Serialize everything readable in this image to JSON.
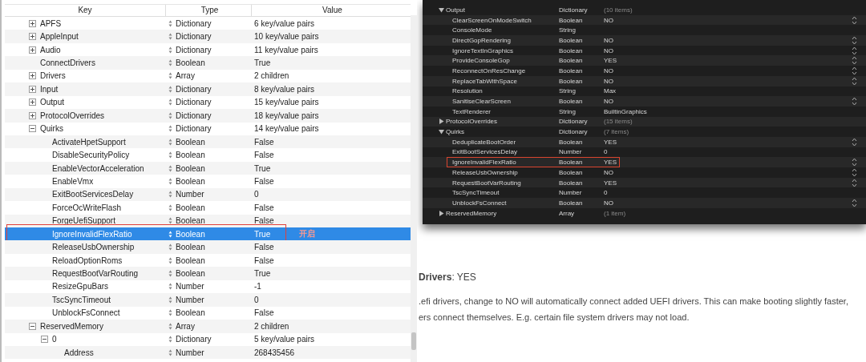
{
  "plist_editor": {
    "columns": [
      "Key",
      "Type",
      "Value"
    ],
    "rows": [
      {
        "key": "APFS",
        "kind": "group",
        "expanded": false,
        "type": "Dictionary",
        "value": "6 key/value pairs",
        "selected": false
      },
      {
        "key": "AppleInput",
        "kind": "group",
        "expanded": false,
        "type": "Dictionary",
        "value": "10 key/value pairs",
        "selected": false
      },
      {
        "key": "Audio",
        "kind": "group",
        "expanded": false,
        "type": "Dictionary",
        "value": "11 key/value pairs",
        "selected": false
      },
      {
        "key": "ConnectDrivers",
        "kind": "leaf",
        "type": "Boolean",
        "value": "True",
        "selected": false
      },
      {
        "key": "Drivers",
        "kind": "group",
        "expanded": false,
        "type": "Array",
        "value": "2 children",
        "selected": false
      },
      {
        "key": "Input",
        "kind": "group",
        "expanded": false,
        "type": "Dictionary",
        "value": "8 key/value pairs",
        "selected": false
      },
      {
        "key": "Output",
        "kind": "group",
        "expanded": false,
        "type": "Dictionary",
        "value": "15 key/value pairs",
        "selected": false
      },
      {
        "key": "ProtocolOverrides",
        "kind": "group",
        "expanded": false,
        "type": "Dictionary",
        "value": "18 key/value pairs",
        "selected": false
      },
      {
        "key": "Quirks",
        "kind": "group",
        "expanded": true,
        "type": "Dictionary",
        "value": "14 key/value pairs",
        "selected": false,
        "children": [
          {
            "key": "ActivateHpetSupport",
            "kind": "leaf",
            "type": "Boolean",
            "value": "False",
            "selected": false
          },
          {
            "key": "DisableSecurityPolicy",
            "kind": "leaf",
            "type": "Boolean",
            "value": "False",
            "selected": false
          },
          {
            "key": "EnableVectorAcceleration",
            "kind": "leaf",
            "type": "Boolean",
            "value": "True",
            "selected": false
          },
          {
            "key": "EnableVmx",
            "kind": "leaf",
            "type": "Boolean",
            "value": "False",
            "selected": false
          },
          {
            "key": "ExitBootServicesDelay",
            "kind": "leaf",
            "type": "Number",
            "value": "0",
            "selected": false
          },
          {
            "key": "ForceOcWriteFlash",
            "kind": "leaf",
            "type": "Boolean",
            "value": "False",
            "selected": false
          },
          {
            "key": "ForgeUefiSupport",
            "kind": "leaf",
            "type": "Boolean",
            "value": "False",
            "selected": false
          },
          {
            "key": "IgnoreInvalidFlexRatio",
            "kind": "leaf",
            "type": "Boolean",
            "value": "True",
            "selected": true,
            "highlighted": true
          },
          {
            "key": "ReleaseUsbOwnership",
            "kind": "leaf",
            "type": "Boolean",
            "value": "False",
            "selected": false
          },
          {
            "key": "ReloadOptionRoms",
            "kind": "leaf",
            "type": "Boolean",
            "value": "False",
            "selected": false
          },
          {
            "key": "RequestBootVarRouting",
            "kind": "leaf",
            "type": "Boolean",
            "value": "True",
            "selected": false
          },
          {
            "key": "ResizeGpuBars",
            "kind": "leaf",
            "type": "Number",
            "value": "-1",
            "selected": false
          },
          {
            "key": "TscSyncTimeout",
            "kind": "leaf",
            "type": "Number",
            "value": "0",
            "selected": false
          },
          {
            "key": "UnblockFsConnect",
            "kind": "leaf",
            "type": "Boolean",
            "value": "False",
            "selected": false
          }
        ]
      },
      {
        "key": "ReservedMemory",
        "kind": "group",
        "expanded": true,
        "type": "Array",
        "value": "2 children",
        "selected": false,
        "children": [
          {
            "key": "0",
            "kind": "group",
            "expanded": true,
            "type": "Dictionary",
            "value": "5 key/value pairs",
            "selected": false,
            "children": [
              {
                "key": "Address",
                "kind": "leaf",
                "type": "Number",
                "value": "268435456",
                "selected": false
              }
            ]
          }
        ]
      }
    ],
    "annotation": "开启"
  },
  "dark_editor": {
    "rows": [
      {
        "key": "Output",
        "kind": "group",
        "expanded": true,
        "type": "Dictionary",
        "value": "(10 items)",
        "children": [
          {
            "key": "ClearScreenOnModeSwitch",
            "kind": "leaf",
            "type": "Boolean",
            "value": "NO",
            "stepper": true
          },
          {
            "key": "ConsoleMode",
            "kind": "leaf",
            "type": "String",
            "stepper": false
          },
          {
            "key": "DirectGopRendering",
            "kind": "leaf",
            "type": "Boolean",
            "value": "NO",
            "stepper": true
          },
          {
            "key": "IgnoreTextInGraphics",
            "kind": "leaf",
            "type": "Boolean",
            "value": "NO",
            "stepper": true
          },
          {
            "key": "ProvideConsoleGop",
            "kind": "leaf",
            "type": "Boolean",
            "value": "YES",
            "stepper": true
          },
          {
            "key": "ReconnectOnResChange",
            "kind": "leaf",
            "type": "Boolean",
            "value": "NO",
            "stepper": true
          },
          {
            "key": "ReplaceTabWithSpace",
            "kind": "leaf",
            "type": "Boolean",
            "value": "NO",
            "stepper": true
          },
          {
            "key": "Resolution",
            "kind": "leaf",
            "type": "String",
            "value": "Max",
            "stepper": false
          },
          {
            "key": "SanitiseClearScreen",
            "kind": "leaf",
            "type": "Boolean",
            "value": "NO",
            "stepper": true
          },
          {
            "key": "TextRenderer",
            "kind": "leaf",
            "type": "String",
            "value": "BuiltinGraphics",
            "stepper": false
          }
        ]
      },
      {
        "key": "ProtocolOverrides",
        "kind": "group",
        "expanded": false,
        "type": "Dictionary",
        "value": "(15 items)"
      },
      {
        "key": "Quirks",
        "kind": "group",
        "expanded": true,
        "type": "Dictionary",
        "value": "(7 items)",
        "children": [
          {
            "key": "DeduplicateBootOrder",
            "kind": "leaf",
            "type": "Boolean",
            "value": "YES",
            "stepper": true
          },
          {
            "key": "ExitBootServicesDelay",
            "kind": "leaf",
            "type": "Number",
            "value": "0",
            "stepper": false
          },
          {
            "key": "IgnoreInvalidFlexRatio",
            "kind": "leaf",
            "type": "Boolean",
            "value": "YES",
            "stepper": true,
            "highlighted": true
          },
          {
            "key": "ReleaseUsbOwnership",
            "kind": "leaf",
            "type": "Boolean",
            "value": "NO",
            "stepper": true
          },
          {
            "key": "RequestBootVarRouting",
            "kind": "leaf",
            "type": "Boolean",
            "value": "YES",
            "stepper": true
          },
          {
            "key": "TscSyncTimeout",
            "kind": "leaf",
            "type": "Number",
            "value": "0",
            "stepper": false
          },
          {
            "key": "UnblockFsConnect",
            "kind": "leaf",
            "type": "Boolean",
            "value": "NO",
            "stepper": true
          }
        ]
      },
      {
        "key": "ReservedMemory",
        "kind": "group",
        "expanded": false,
        "type": "Array",
        "value": "(1 item)"
      }
    ]
  },
  "doc_text": {
    "heading": "**Drivers**: YES",
    "lines": [
      ".efi drivers, change to NO will automatically connect added UEFI drivers. This can make booting slightly faster,",
      "ers connect themselves. E.g. certain file system drivers may not load."
    ]
  }
}
